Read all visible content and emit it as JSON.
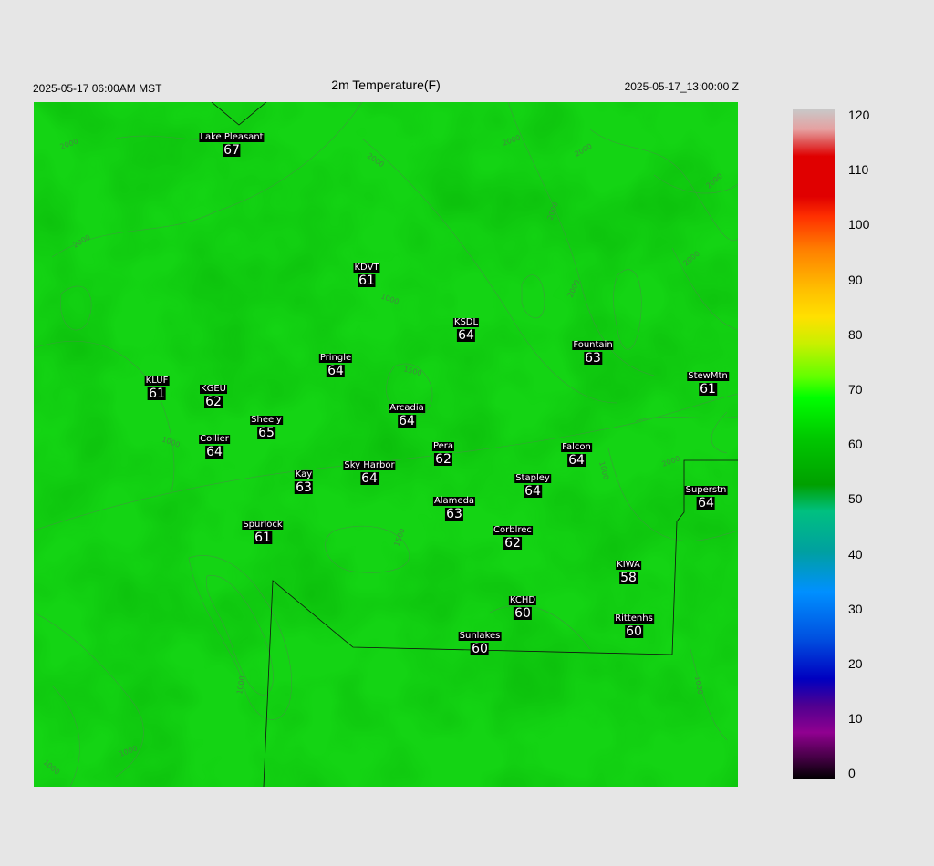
{
  "header": {
    "local_time": "2025-05-17 06:00AM MST",
    "title": "2m Temperature(F)",
    "utc_time": "2025-05-17_13:00:00 Z"
  },
  "contour_labels": [
    "1000",
    "1500",
    "2000",
    "2500"
  ],
  "stations": [
    {
      "name": "Lake Pleasant",
      "temp": "67"
    },
    {
      "name": "KDVT",
      "temp": "61"
    },
    {
      "name": "KSDL",
      "temp": "64"
    },
    {
      "name": "Fountain",
      "temp": "63"
    },
    {
      "name": "Pringle",
      "temp": "64"
    },
    {
      "name": "KLUF",
      "temp": "61"
    },
    {
      "name": "KGEU",
      "temp": "62"
    },
    {
      "name": "StewMtn",
      "temp": "61"
    },
    {
      "name": "Arcadia",
      "temp": "64"
    },
    {
      "name": "Sheely",
      "temp": "65"
    },
    {
      "name": "Collier",
      "temp": "64"
    },
    {
      "name": "Pera",
      "temp": "62"
    },
    {
      "name": "Falcon",
      "temp": "64"
    },
    {
      "name": "Sky Harbor",
      "temp": "64"
    },
    {
      "name": "Kay",
      "temp": "63"
    },
    {
      "name": "Stapley",
      "temp": "64"
    },
    {
      "name": "Superstn",
      "temp": "64"
    },
    {
      "name": "Alameda",
      "temp": "63"
    },
    {
      "name": "Spurlock",
      "temp": "61"
    },
    {
      "name": "Corblrec",
      "temp": "62"
    },
    {
      "name": "KIWA",
      "temp": "58"
    },
    {
      "name": "KCHD",
      "temp": "60"
    },
    {
      "name": "Rittenhs",
      "temp": "60"
    },
    {
      "name": "Sunlakes",
      "temp": "60"
    }
  ],
  "colorbar": {
    "ticks": [
      "120",
      "110",
      "100",
      "90",
      "80",
      "70",
      "60",
      "50",
      "40",
      "30",
      "20",
      "10",
      "0"
    ],
    "colors": [
      "#c8c8c8",
      "#e6a0a0",
      "#e05050",
      "#e00000",
      "#ff3000",
      "#ff8000",
      "#ffc000",
      "#ffe000",
      "#c8f000",
      "#60ff00",
      "#00ff00",
      "#00c800",
      "#00a000",
      "#00c080",
      "#00a0a0",
      "#0090ff",
      "#0050e0",
      "#0000c0",
      "#500090",
      "#900090",
      "#000000"
    ]
  }
}
